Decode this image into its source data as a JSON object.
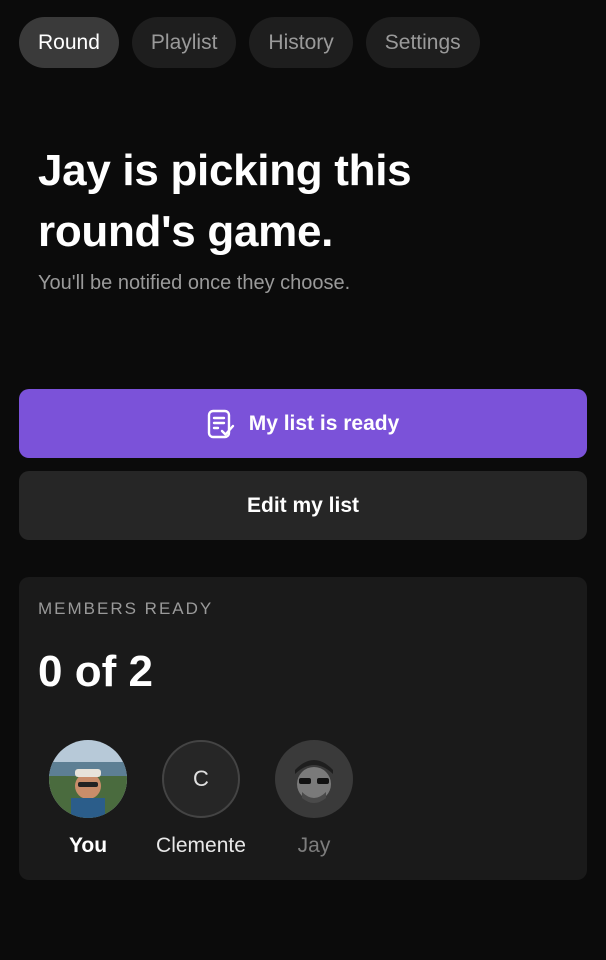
{
  "tabs": [
    {
      "label": "Round",
      "active": true
    },
    {
      "label": "Playlist",
      "active": false
    },
    {
      "label": "History",
      "active": false
    },
    {
      "label": "Settings",
      "active": false
    }
  ],
  "headline": "Jay is picking this round's game.",
  "subtitle": "You'll be notified once they choose.",
  "buttons": {
    "ready_label": "My list is ready",
    "ready_icon": "checklist-icon",
    "edit_label": "Edit my list"
  },
  "members_card": {
    "label": "MEMBERS READY",
    "count": "0 of 2",
    "members": [
      {
        "name": "You",
        "avatar": "photo"
      },
      {
        "name": "Clemente",
        "avatar": "initial",
        "initial": "C"
      },
      {
        "name": "Jay",
        "avatar": "photo"
      }
    ]
  },
  "colors": {
    "background": "#0b0b0b",
    "accent": "#7b52d9",
    "surface": "#1a1a1a",
    "muted_text": "#9a9a9a"
  }
}
